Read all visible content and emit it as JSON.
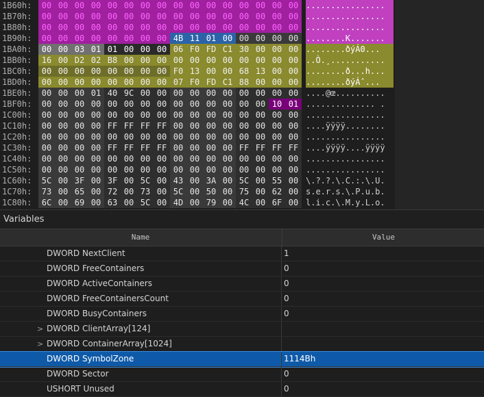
{
  "hex_view": {
    "rows": [
      {
        "addr": "1B60h:",
        "bytes": [
          "00",
          "00",
          "00",
          "00",
          "00",
          "00",
          "00",
          "00",
          "00",
          "00",
          "00",
          "00",
          "00",
          "00",
          "00",
          "00"
        ],
        "ascii": "................"
      },
      {
        "addr": "1B70h:",
        "bytes": [
          "00",
          "00",
          "00",
          "00",
          "00",
          "00",
          "00",
          "00",
          "00",
          "00",
          "00",
          "00",
          "00",
          "00",
          "00",
          "00"
        ],
        "ascii": "................"
      },
      {
        "addr": "1B80h:",
        "bytes": [
          "00",
          "00",
          "00",
          "00",
          "00",
          "00",
          "00",
          "00",
          "00",
          "00",
          "00",
          "00",
          "00",
          "00",
          "00",
          "00"
        ],
        "ascii": "................"
      },
      {
        "addr": "1B90h:",
        "bytes": [
          "00",
          "00",
          "00",
          "00",
          "00",
          "00",
          "00",
          "00",
          "4B",
          "11",
          "01",
          "00",
          "00",
          "00",
          "00",
          "00"
        ],
        "ascii": "........K......."
      },
      {
        "addr": "1BA0h:",
        "bytes": [
          "00",
          "00",
          "03",
          "01",
          "01",
          "00",
          "00",
          "00",
          "06",
          "F0",
          "FD",
          "C1",
          "30",
          "00",
          "00",
          "00"
        ],
        "ascii": "........ðýÁ0..."
      },
      {
        "addr": "1BB0h:",
        "bytes": [
          "16",
          "00",
          "D2",
          "02",
          "B8",
          "00",
          "00",
          "00",
          "00",
          "00",
          "00",
          "00",
          "00",
          "00",
          "00",
          "00"
        ],
        "ascii": "..Ò.¸..........."
      },
      {
        "addr": "1BC0h:",
        "bytes": [
          "00",
          "00",
          "00",
          "00",
          "00",
          "00",
          "00",
          "00",
          "F0",
          "13",
          "00",
          "00",
          "68",
          "13",
          "00",
          "00"
        ],
        "ascii": "........ð...h..."
      },
      {
        "addr": "1BD0h:",
        "bytes": [
          "00",
          "00",
          "00",
          "00",
          "00",
          "00",
          "00",
          "00",
          "07",
          "F0",
          "FD",
          "C1",
          "88",
          "00",
          "00",
          "00"
        ],
        "ascii": "........ðýÁˆ..."
      },
      {
        "addr": "1BE0h:",
        "bytes": [
          "00",
          "00",
          "00",
          "01",
          "40",
          "9C",
          "00",
          "00",
          "00",
          "00",
          "00",
          "00",
          "00",
          "00",
          "00",
          "00"
        ],
        "ascii": "....@œ.........."
      },
      {
        "addr": "1BF0h:",
        "bytes": [
          "00",
          "00",
          "00",
          "00",
          "00",
          "00",
          "00",
          "00",
          "00",
          "00",
          "00",
          "00",
          "00",
          "00",
          "10",
          "01"
        ],
        "ascii": ".............. ."
      },
      {
        "addr": "1C00h:",
        "bytes": [
          "00",
          "00",
          "00",
          "00",
          "00",
          "00",
          "00",
          "00",
          "00",
          "00",
          "00",
          "00",
          "00",
          "00",
          "00",
          "00"
        ],
        "ascii": "................"
      },
      {
        "addr": "1C10h:",
        "bytes": [
          "00",
          "00",
          "00",
          "00",
          "FF",
          "FF",
          "FF",
          "FF",
          "00",
          "00",
          "00",
          "00",
          "00",
          "00",
          "00",
          "00"
        ],
        "ascii": "....ÿÿÿÿ........"
      },
      {
        "addr": "1C20h:",
        "bytes": [
          "00",
          "00",
          "00",
          "00",
          "00",
          "00",
          "00",
          "00",
          "00",
          "00",
          "00",
          "00",
          "00",
          "00",
          "00",
          "00"
        ],
        "ascii": "................"
      },
      {
        "addr": "1C30h:",
        "bytes": [
          "00",
          "00",
          "00",
          "00",
          "FF",
          "FF",
          "FF",
          "FF",
          "00",
          "00",
          "00",
          "00",
          "FF",
          "FF",
          "FF",
          "FF"
        ],
        "ascii": "....ÿÿÿÿ....ÿÿÿÿ"
      },
      {
        "addr": "1C40h:",
        "bytes": [
          "00",
          "00",
          "00",
          "00",
          "00",
          "00",
          "00",
          "00",
          "00",
          "00",
          "00",
          "00",
          "00",
          "00",
          "00",
          "00"
        ],
        "ascii": "................"
      },
      {
        "addr": "1C50h:",
        "bytes": [
          "00",
          "00",
          "00",
          "00",
          "00",
          "00",
          "00",
          "00",
          "00",
          "00",
          "00",
          "00",
          "00",
          "00",
          "00",
          "00"
        ],
        "ascii": "................"
      },
      {
        "addr": "1C60h:",
        "bytes": [
          "5C",
          "00",
          "3F",
          "00",
          "3F",
          "00",
          "5C",
          "00",
          "43",
          "00",
          "3A",
          "00",
          "5C",
          "00",
          "55",
          "00"
        ],
        "ascii": "\\.?.?.\\.C.:.\\.U."
      },
      {
        "addr": "1C70h:",
        "bytes": [
          "73",
          "00",
          "65",
          "00",
          "72",
          "00",
          "73",
          "00",
          "5C",
          "00",
          "50",
          "00",
          "75",
          "00",
          "62",
          "00"
        ],
        "ascii": "s.e.r.s.\\.P.u.b."
      },
      {
        "addr": "1C80h:",
        "bytes": [
          "6C",
          "00",
          "69",
          "00",
          "63",
          "00",
          "5C",
          "00",
          "4D",
          "00",
          "79",
          "00",
          "4C",
          "00",
          "6F",
          "00"
        ],
        "ascii": "l.i.c.\\.M.y.L.o."
      }
    ]
  },
  "variables_panel": {
    "title": "Variables",
    "col_name": "Name",
    "col_value": "Value",
    "rows": [
      {
        "name": "DWORD NextClient",
        "value": "1",
        "expandable": false,
        "selected": false
      },
      {
        "name": "DWORD FreeContainers",
        "value": "0",
        "expandable": false,
        "selected": false
      },
      {
        "name": "DWORD ActiveContainers",
        "value": "0",
        "expandable": false,
        "selected": false
      },
      {
        "name": "DWORD FreeContainersCount",
        "value": "0",
        "expandable": false,
        "selected": false
      },
      {
        "name": "DWORD BusyContainers",
        "value": "0",
        "expandable": false,
        "selected": false
      },
      {
        "name": "DWORD ClientArray[124]",
        "value": "",
        "expandable": true,
        "selected": false
      },
      {
        "name": "DWORD ContainerArray[1024]",
        "value": "",
        "expandable": true,
        "selected": false
      },
      {
        "name": "DWORD SymbolZone",
        "value": "1114Bh",
        "expandable": false,
        "selected": true
      },
      {
        "name": "DWORD Sector",
        "value": "0",
        "expandable": false,
        "selected": false
      },
      {
        "name": "USHORT Unused",
        "value": "0",
        "expandable": false,
        "selected": false
      }
    ]
  },
  "colors": {
    "unused_bg": "#a020a0",
    "unused_fg": "#ff66ff",
    "struct_a": "#707070",
    "struct_b": "#8a8a2e",
    "selected_field": "#2b63a8",
    "field_marker": "#7a007a",
    "plain_a": "#3a3a3a",
    "plain_b": "#2e2e2e"
  },
  "expander_glyph": ">"
}
